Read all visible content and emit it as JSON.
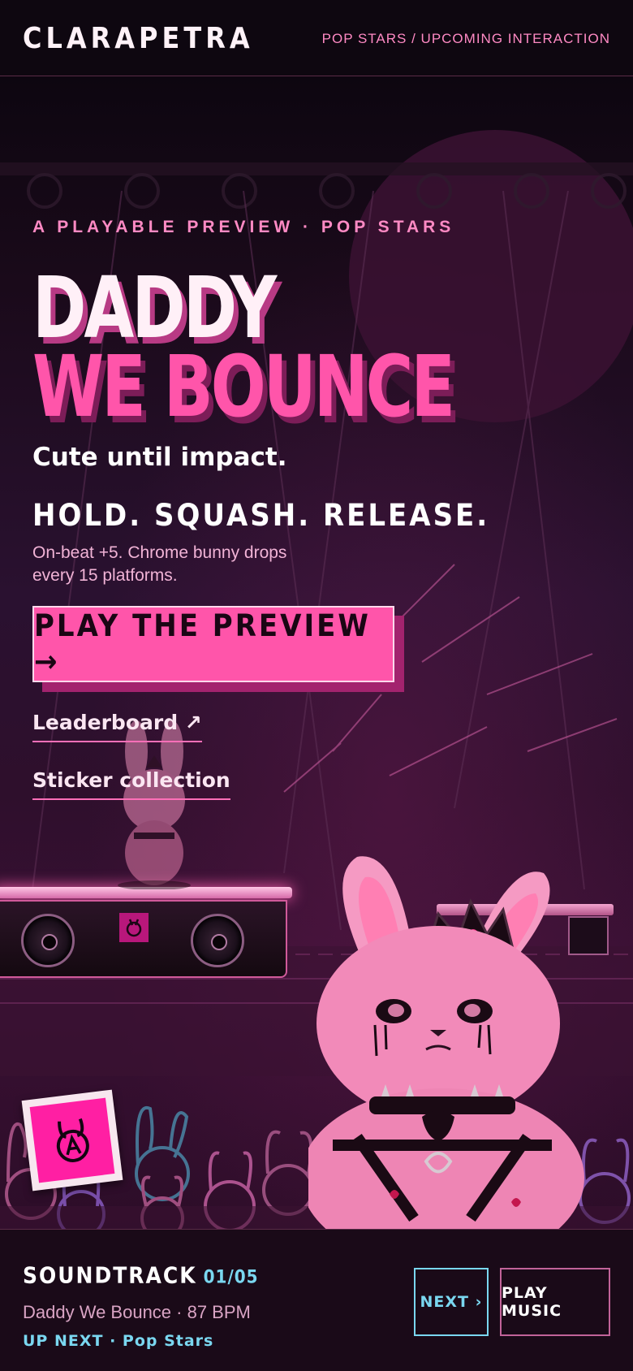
{
  "header": {
    "brand": "CLARAPETRA",
    "breadcrumb": "POP STARS / UPCOMING INTERACTION"
  },
  "hero": {
    "eyebrow": "A PLAYABLE PREVIEW · POP STARS",
    "title_line_1": "DADDY",
    "title_line_2": "WE BOUNCE",
    "tagline": "Cute until impact.",
    "instruction": "HOLD. SQUASH. RELEASE.",
    "description_lines": [
      "On-beat +5. Chrome bunny drops",
      "every 15 platforms."
    ],
    "cta_label": "PLAY THE PREVIEW →",
    "links": {
      "leaderboard": "Leaderboard ↗",
      "stickers": "Sticker collection"
    }
  },
  "footer": {
    "soundtrack_label": "SOUNDTRACK",
    "track_counter": "01/05",
    "track_info": "Daddy We Bounce · 87 BPM",
    "up_next": "UP NEXT · Pop Stars",
    "next_button": "NEXT ›",
    "play_button": "PLAY MUSIC"
  },
  "colors": {
    "accent_pink": "#ff55aa",
    "accent_cyan": "#7ad7f0",
    "background": "#0d0610"
  },
  "icons": [
    "arrow-right-icon",
    "external-link-icon",
    "bunny-logo-icon",
    "speaker-icon",
    "chevron-right-icon"
  ]
}
